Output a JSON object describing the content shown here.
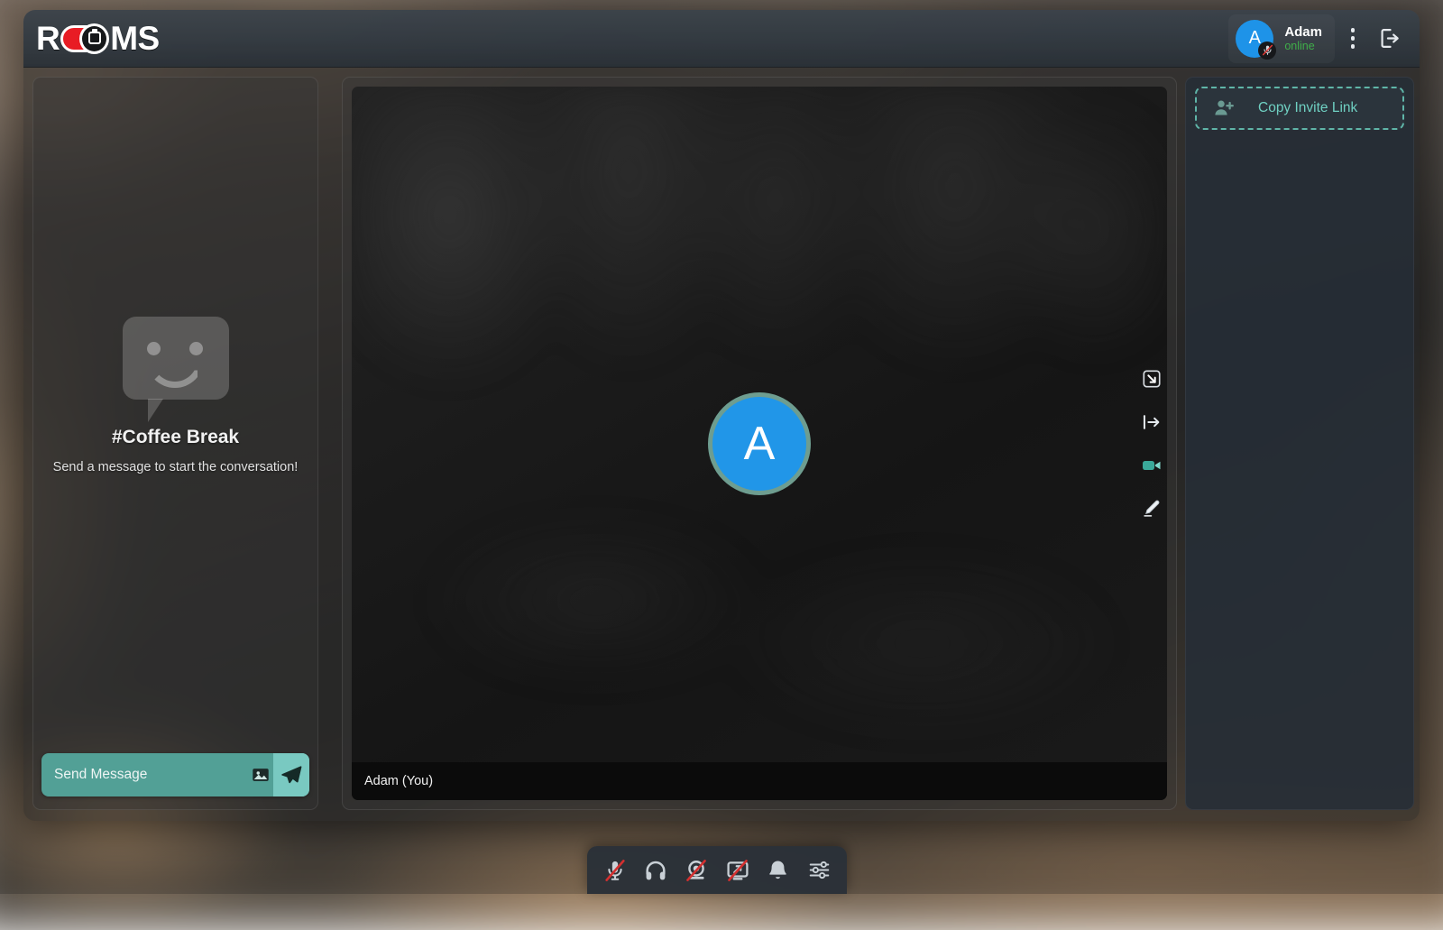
{
  "app": {
    "brand_name": "ROOMS",
    "brand_logo_text_left": "R",
    "brand_logo_text_right": "MS"
  },
  "header": {
    "user": {
      "avatar_initial": "A",
      "name": "Adam",
      "status": "online",
      "mic_badge_icon": "mic-muted-icon"
    },
    "more_menu_icon": "kebab-menu-icon",
    "logout_icon": "logout-icon"
  },
  "chat": {
    "room_title": "#Coffee Break",
    "empty_subtitle": "Send a message to start the conversation!",
    "empty_icon": "smiley-speech-bubble-icon",
    "composer": {
      "placeholder": "Send Message",
      "value": "",
      "attach_icon": "image-icon",
      "send_icon": "send-paper-plane-icon"
    },
    "swap_icon": "swap-panels-icon"
  },
  "video": {
    "participant": {
      "avatar_initial": "A",
      "name_label": "Adam (You)"
    },
    "controls": [
      {
        "name": "resize-collapse-button",
        "icon": "arrow-into-corner-icon",
        "active": false
      },
      {
        "name": "pin-move-button",
        "icon": "arrow-into-bracket-icon",
        "active": false
      },
      {
        "name": "toggle-camera-button",
        "icon": "video-camera-icon",
        "active": true
      },
      {
        "name": "annotate-button",
        "icon": "pencil-icon",
        "active": false
      }
    ]
  },
  "sidebar": {
    "copy_invite_label": "Copy Invite Link",
    "copy_invite_icon": "person-plus-icon"
  },
  "toolbar": {
    "buttons": [
      {
        "name": "toggle-microphone-button",
        "icon": "microphone-icon",
        "label": "Microphone",
        "muted": true
      },
      {
        "name": "toggle-audio-output-button",
        "icon": "headphones-icon",
        "label": "Headphones",
        "muted": false
      },
      {
        "name": "toggle-webcam-button",
        "icon": "webcam-icon",
        "label": "Webcam",
        "muted": true
      },
      {
        "name": "toggle-screenshare-button",
        "icon": "screen-share-icon",
        "label": "Screen Share",
        "muted": true
      },
      {
        "name": "notifications-button",
        "icon": "bell-icon",
        "label": "Notifications",
        "muted": false
      },
      {
        "name": "settings-button",
        "icon": "sliders-icon",
        "label": "Settings",
        "muted": false
      }
    ]
  },
  "colors": {
    "accent_teal": "#52a096",
    "send_button": "#79c9c1",
    "invite_text": "#6fd0c2",
    "avatar_blue": "#2196e8",
    "avatar_ring": "#6e9d90",
    "status_online": "#3fae4a",
    "logo_red": "#e81c24",
    "mute_slash_red": "#d32f2f"
  }
}
